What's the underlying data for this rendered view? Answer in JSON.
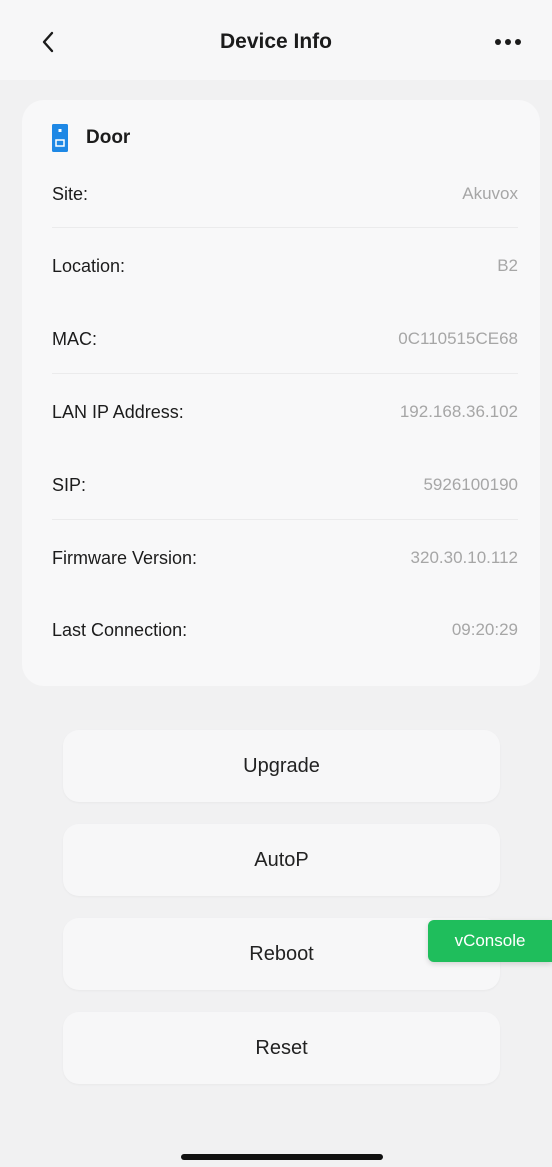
{
  "header": {
    "title": "Device Info",
    "back_icon": "chevron-left-icon",
    "more_icon": "more-horizontal-icon"
  },
  "card": {
    "title": "Door",
    "icon": "door-icon",
    "icon_color": "#1e88e5",
    "rows": [
      {
        "label": "Site:",
        "value": "Akuvox"
      },
      {
        "label": "Location:",
        "value": "B2"
      },
      {
        "label": "MAC:",
        "value": "0C110515CE68"
      },
      {
        "label": "LAN IP Address:",
        "value": "192.168.36.102"
      },
      {
        "label": "SIP:",
        "value": "5926100190"
      },
      {
        "label": "Firmware Version:",
        "value": "320.30.10.112"
      },
      {
        "label": "Last Connection:",
        "value": "09:20:29"
      }
    ]
  },
  "actions": {
    "upgrade": "Upgrade",
    "autop": "AutoP",
    "reboot": "Reboot",
    "reset": "Reset"
  },
  "vconsole": {
    "label": "vConsole",
    "color": "#1fbe5c"
  }
}
